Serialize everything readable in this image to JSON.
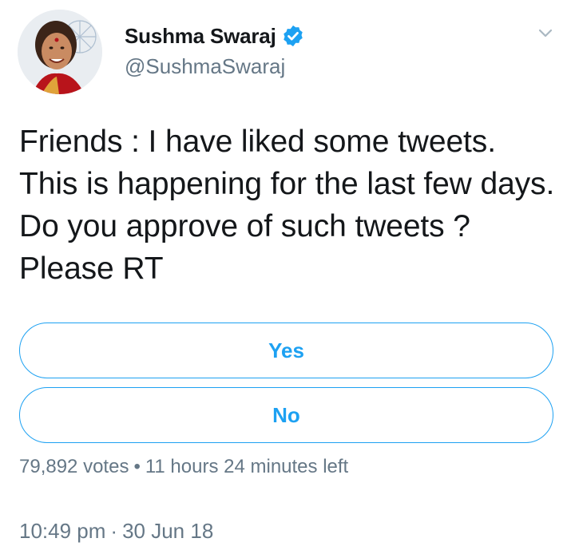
{
  "author": {
    "display_name": "Sushma Swaraj",
    "handle": "@SushmaSwaraj",
    "verified_icon": "verified-badge-icon",
    "avatar_icon": "avatar"
  },
  "menu": {
    "icon": "chevron-down-icon"
  },
  "tweet": {
    "text": "Friends : I have liked some tweets. This is happening for the last few days. Do you approve of such tweets ? Please RT"
  },
  "poll": {
    "options": [
      {
        "label": "Yes"
      },
      {
        "label": "No"
      }
    ],
    "votes": "79,892 votes",
    "separator": "•",
    "time_left": "11 hours 24 minutes left"
  },
  "footer": {
    "time": "10:49 pm",
    "separator": "·",
    "date": "30 Jun 18"
  },
  "colors": {
    "accent": "#1da1f2",
    "text_primary": "#14171a",
    "text_secondary": "#657786"
  }
}
